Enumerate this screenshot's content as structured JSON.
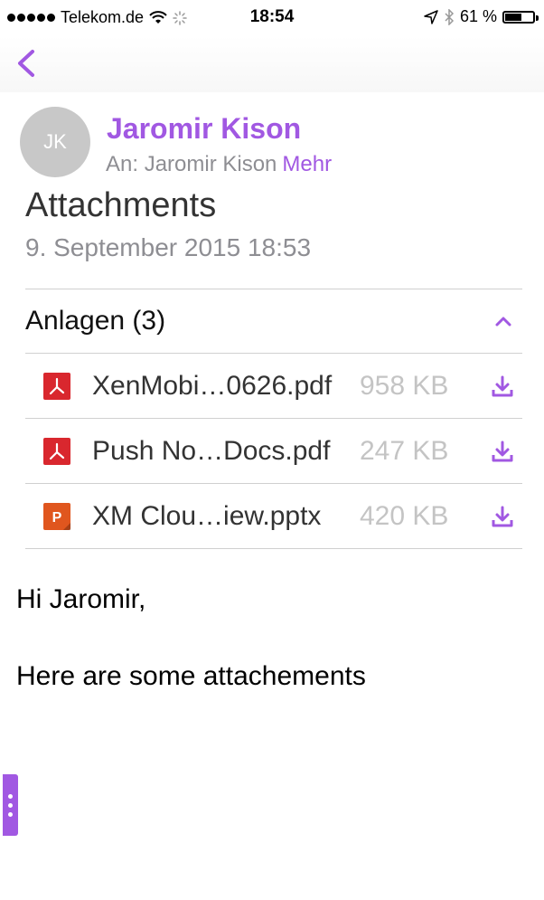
{
  "status_bar": {
    "carrier": "Telekom.de",
    "time": "18:54",
    "battery_percent": "61 %",
    "battery_level": 0.61
  },
  "nav": {
    "back_icon": "chevron-left-icon"
  },
  "message": {
    "avatar_initials": "JK",
    "sender": "Jaromir Kison",
    "recipients_label": "An: Jaromir Kison",
    "more_label": "Mehr",
    "subject": "Attachments",
    "date": "9. September 2015 18:53"
  },
  "attachments": {
    "title": "Anlagen (3)",
    "items": [
      {
        "name": "XenMobi…0626.pdf",
        "size": "958 KB",
        "type": "pdf",
        "icon_glyph": "⅄"
      },
      {
        "name": "Push No…Docs.pdf",
        "size": "247 KB",
        "type": "pdf",
        "icon_glyph": "⅄"
      },
      {
        "name": "XM Clou…iew.pptx",
        "size": "420 KB",
        "type": "pptx",
        "icon_glyph": "P"
      }
    ]
  },
  "body": {
    "greeting": "Hi Jaromir,",
    "line1": "Here are some attachements"
  },
  "colors": {
    "accent": "#a158e2",
    "pdf": "#d9272e",
    "pptx": "#e0561e",
    "muted": "#8e8e93"
  }
}
